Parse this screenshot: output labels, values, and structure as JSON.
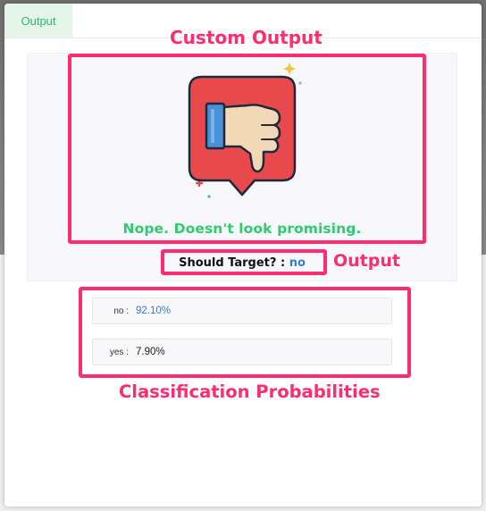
{
  "tabs": [
    {
      "label": "Output"
    }
  ],
  "custom_output": {
    "message": "Nope. Doesn't look promising.",
    "icon": "thumbs-down-icon",
    "icon_colors": {
      "tile": "#e8494c",
      "hand": "#f3d8b8",
      "cuff": "#4a90d9",
      "outline": "#1d2a3a"
    }
  },
  "prediction": {
    "label": "Should Target? :",
    "value": "no"
  },
  "probabilities": [
    {
      "label": "no :",
      "value": "92.10%"
    },
    {
      "label": "yes :",
      "value": "7.90%"
    }
  ],
  "annotations": {
    "custom_output": "Custom Output",
    "output": "Output",
    "probabilities": "Classification Probabilities"
  },
  "colors": {
    "accent_green": "#2ecc71",
    "accent_blue": "#2f7de1",
    "annotation_pink": "#ff2d6f",
    "tab_bg": "#e6f5ea"
  }
}
